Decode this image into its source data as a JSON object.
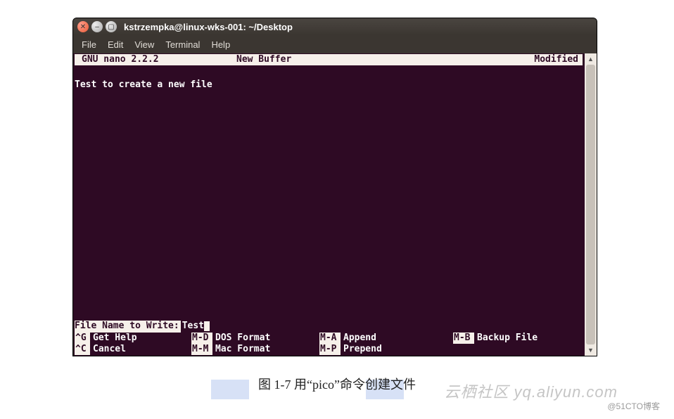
{
  "window": {
    "title": "kstrzempka@linux-wks-001: ~/Desktop"
  },
  "menu": {
    "items": [
      "File",
      "Edit",
      "View",
      "Terminal",
      "Help"
    ]
  },
  "nano": {
    "header": {
      "left": "GNU nano 2.2.2",
      "center": "New Buffer",
      "right": "Modified"
    },
    "body": "\nTest to create a new file",
    "prompt": {
      "label": "File Name to Write:",
      "value": "Test"
    },
    "shortcuts": {
      "row1": [
        {
          "key": "^G",
          "desc": "Get Help"
        },
        {
          "key": "M-D",
          "desc": "DOS Format"
        },
        {
          "key": "M-A",
          "desc": "Append"
        },
        {
          "key": "M-B",
          "desc": "Backup File"
        }
      ],
      "row2": [
        {
          "key": "^C",
          "desc": "Cancel"
        },
        {
          "key": "M-M",
          "desc": "Mac Format"
        },
        {
          "key": "M-P",
          "desc": "Prepend"
        },
        {
          "key": "",
          "desc": ""
        }
      ]
    }
  },
  "caption": "图 1-7    用“pico”命令创建文件",
  "watermark": {
    "text1": "云栖社区 yq.aliyun.com",
    "text2": "@51CTO博客"
  }
}
